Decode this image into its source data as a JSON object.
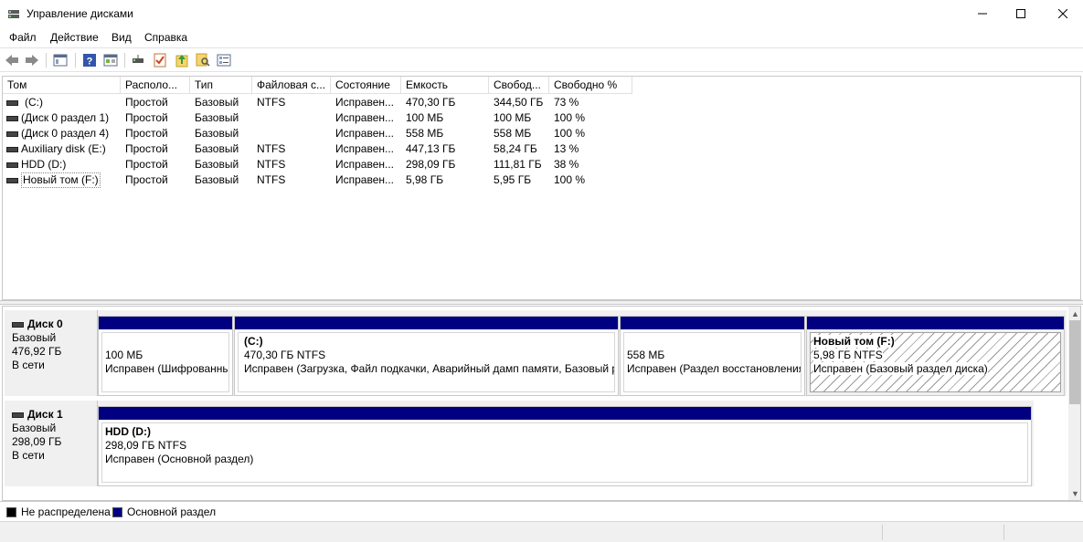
{
  "window": {
    "title": "Управление дисками",
    "minimize_glyph": "—",
    "maximize_glyph": "☐",
    "close_glyph": "✕"
  },
  "menu": [
    "Файл",
    "Действие",
    "Вид",
    "Справка"
  ],
  "toolbar": {
    "icons": [
      "back-arrow-icon",
      "forward-arrow-icon",
      "console-tree-icon",
      "help-icon",
      "properties-icon",
      "connect-disk-icon",
      "check-icon",
      "upload-icon",
      "search-icon",
      "list-view-icon"
    ]
  },
  "volume_list": {
    "columns": [
      "Том",
      "Располо...",
      "Тип",
      "Файловая с...",
      "Состояние",
      "Емкость",
      "Свобод...",
      "Свободно %"
    ],
    "rows": [
      {
        "volume": "(C:)",
        "layout": "Простой",
        "type": "Базовый",
        "fs": "NTFS",
        "status": "Исправен...",
        "capacity": "470,30 ГБ",
        "free": "344,50 ГБ",
        "free_pct": "73 %"
      },
      {
        "volume": "(Диск 0 раздел 1)",
        "layout": "Простой",
        "type": "Базовый",
        "fs": "",
        "status": "Исправен...",
        "capacity": "100 МБ",
        "free": "100 МБ",
        "free_pct": "100 %"
      },
      {
        "volume": "(Диск 0 раздел 4)",
        "layout": "Простой",
        "type": "Базовый",
        "fs": "",
        "status": "Исправен...",
        "capacity": "558 МБ",
        "free": "558 МБ",
        "free_pct": "100 %"
      },
      {
        "volume": "Auxiliary disk (E:)",
        "layout": "Простой",
        "type": "Базовый",
        "fs": "NTFS",
        "status": "Исправен...",
        "capacity": "447,13 ГБ",
        "free": "58,24 ГБ",
        "free_pct": "13 %"
      },
      {
        "volume": "HDD (D:)",
        "layout": "Простой",
        "type": "Базовый",
        "fs": "NTFS",
        "status": "Исправен...",
        "capacity": "298,09 ГБ",
        "free": "111,81 ГБ",
        "free_pct": "38 %"
      },
      {
        "volume": "Новый том (F:)",
        "layout": "Простой",
        "type": "Базовый",
        "fs": "NTFS",
        "status": "Исправен...",
        "capacity": "5,98 ГБ",
        "free": "5,95 ГБ",
        "free_pct": "100 %"
      }
    ]
  },
  "disks": [
    {
      "name": "Диск 0",
      "type": "Базовый",
      "size": "476,92 ГБ",
      "state": "В сети",
      "partitions": [
        {
          "name": "",
          "size": "100 МБ",
          "status": "Исправен (Шифрованный (EFI) системный раздел)"
        },
        {
          "name": "(C:)",
          "size": "470,30 ГБ NTFS",
          "status": "Исправен (Загрузка, Файл подкачки, Аварийный дамп памяти, Базовый раздел)"
        },
        {
          "name": "",
          "size": "558 МБ",
          "status": "Исправен (Раздел восстановления)"
        },
        {
          "name": "Новый том  (F:)",
          "size": "5,98 ГБ NTFS",
          "status": "Исправен (Базовый раздел диска)"
        }
      ]
    },
    {
      "name": "Диск 1",
      "type": "Базовый",
      "size": "298,09 ГБ",
      "state": "В сети",
      "partitions": [
        {
          "name": "HDD  (D:)",
          "size": "298,09 ГБ NTFS",
          "status": "Исправен (Основной раздел)"
        }
      ]
    }
  ],
  "legend": [
    {
      "label": "Не распределена",
      "color": "#000000"
    },
    {
      "label": "Основной раздел",
      "color": "#000080"
    }
  ],
  "colors": {
    "partition_bar": "#000080",
    "unallocated": "#000000"
  },
  "scroll": {
    "up_glyph": "▲",
    "down_glyph": "▼"
  }
}
